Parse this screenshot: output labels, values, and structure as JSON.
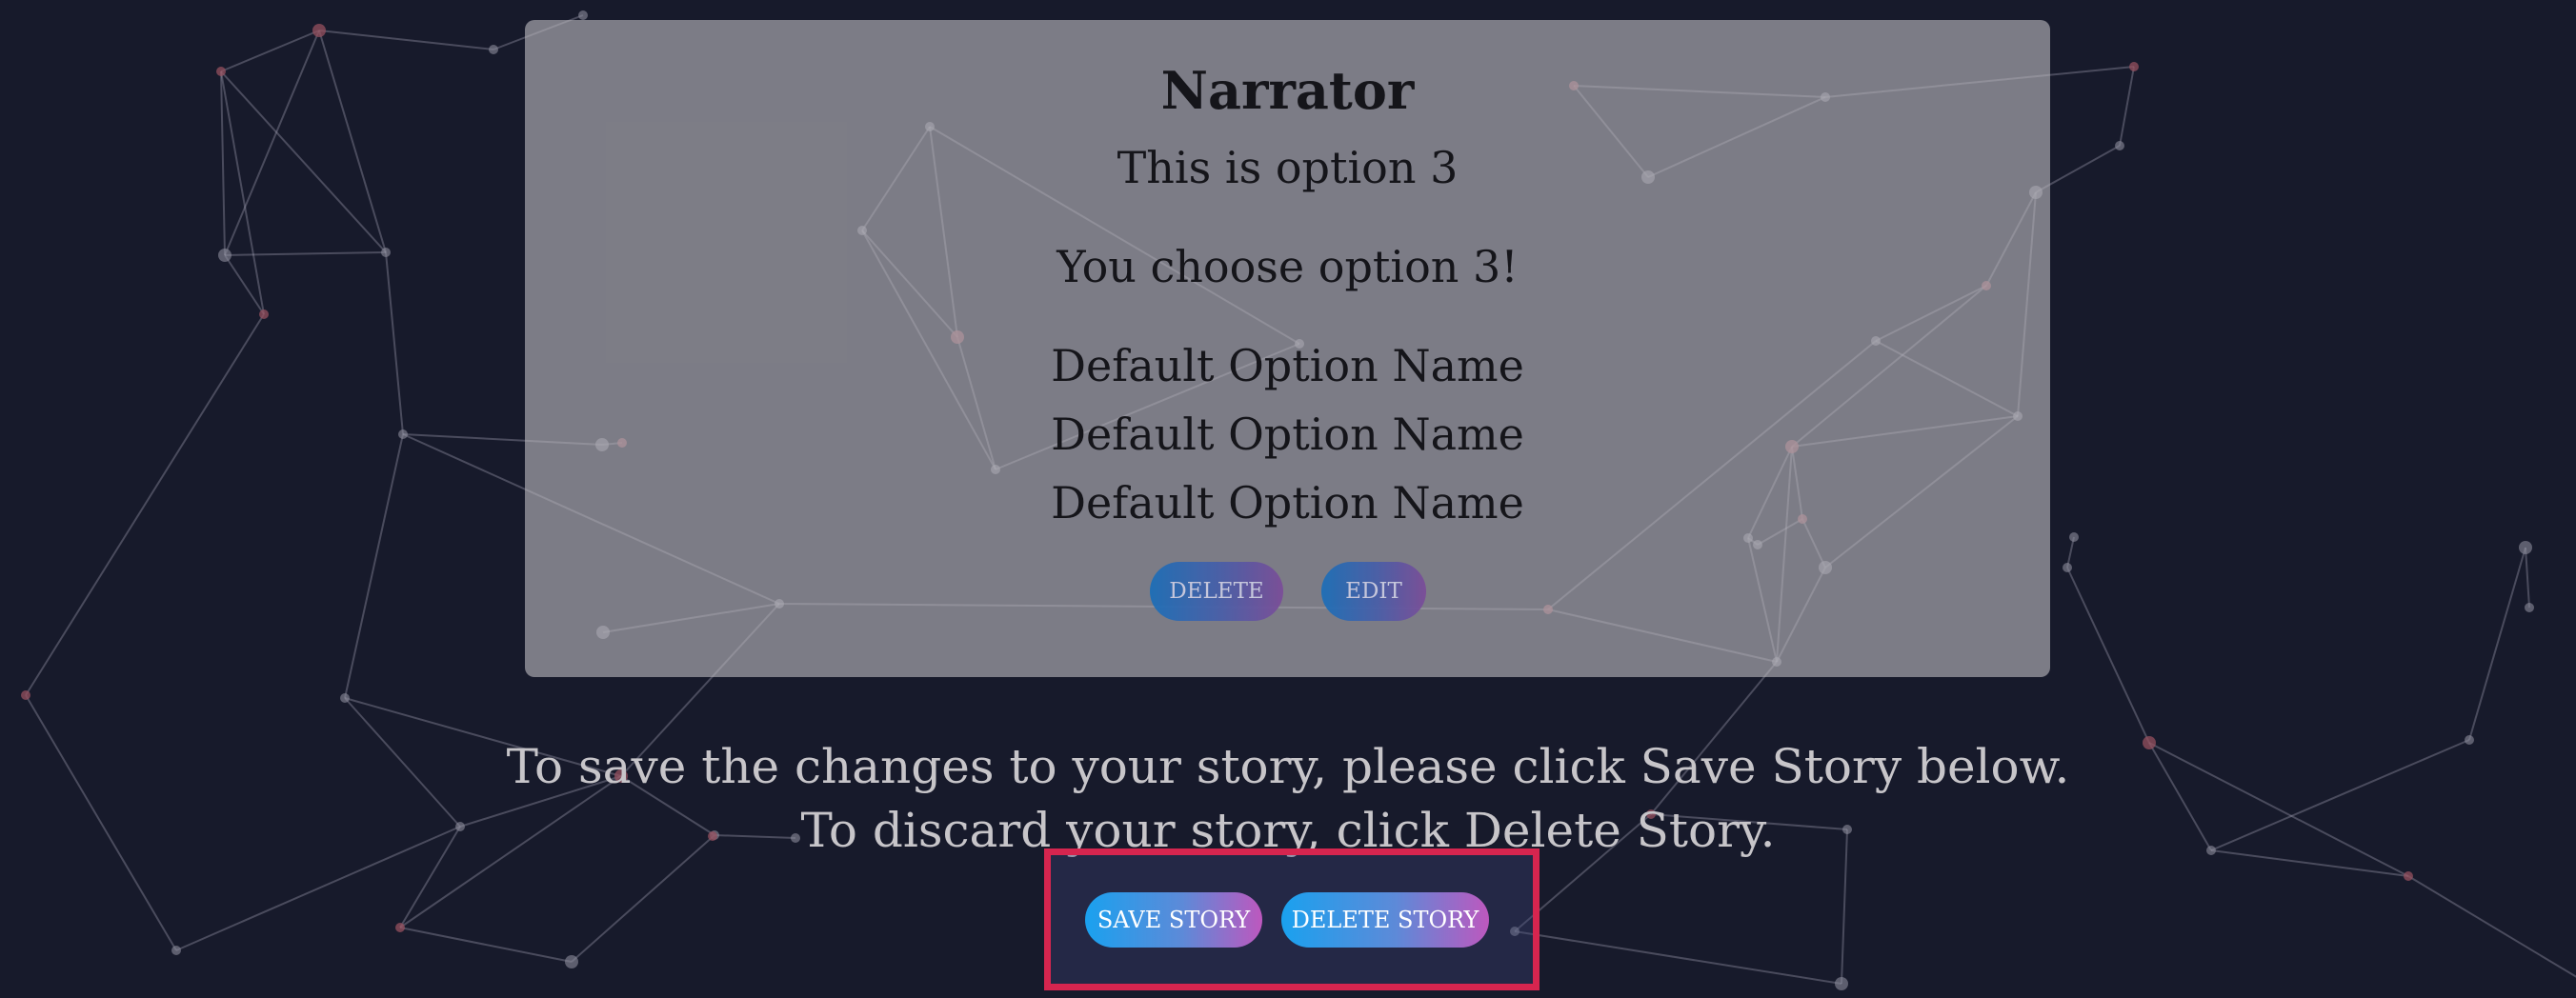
{
  "card": {
    "title": "Narrator",
    "option_text": "This is option 3",
    "choice_text": "You choose option 3!",
    "options": [
      "Default Option Name",
      "Default Option Name",
      "Default Option Name"
    ],
    "delete_label": "DELETE",
    "edit_label": "EDIT"
  },
  "notice": {
    "line1": "To save the changes to your story, please click Save Story below.",
    "line2": "To discard your story, click Delete Story."
  },
  "actions": {
    "save_label": "SAVE STORY",
    "delete_label": "DELETE STORY"
  },
  "colors": {
    "background": "#171a2b",
    "highlight_border": "#d6254f",
    "button_gradient_start": "#1aa1ef",
    "button_gradient_end": "#bd58be"
  }
}
